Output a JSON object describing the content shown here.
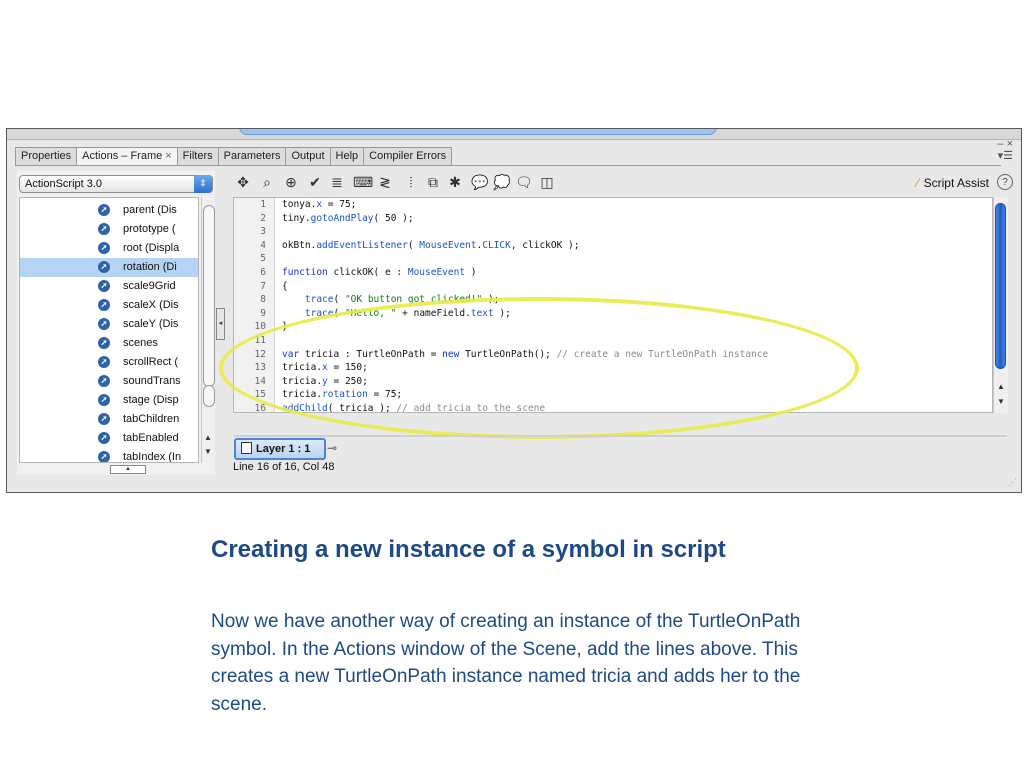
{
  "tabs": [
    {
      "label": "Properties",
      "active": false
    },
    {
      "label": "Actions – Frame",
      "active": true,
      "closable": true
    },
    {
      "label": "Filters",
      "active": false
    },
    {
      "label": "Parameters",
      "active": false
    },
    {
      "label": "Output",
      "active": false
    },
    {
      "label": "Help",
      "active": false
    },
    {
      "label": "Compiler Errors",
      "active": false
    }
  ],
  "panel_controls": {
    "minimize": "–",
    "close": "×",
    "menu": "▾☰"
  },
  "language_select": {
    "value": "ActionScript 3.0",
    "arrow": "⇕"
  },
  "tree_items": [
    {
      "label": "parent (Dis",
      "selected": false
    },
    {
      "label": "prototype (",
      "selected": false
    },
    {
      "label": "root (Displa",
      "selected": false
    },
    {
      "label": "rotation (Di",
      "selected": true
    },
    {
      "label": "scale9Grid",
      "selected": false
    },
    {
      "label": "scaleX (Dis",
      "selected": false
    },
    {
      "label": "scaleY (Dis",
      "selected": false
    },
    {
      "label": "scenes",
      "selected": false
    },
    {
      "label": "scrollRect (",
      "selected": false
    },
    {
      "label": "soundTrans",
      "selected": false
    },
    {
      "label": "stage (Disp",
      "selected": false
    },
    {
      "label": "tabChildren",
      "selected": false
    },
    {
      "label": "tabEnabled",
      "selected": false
    },
    {
      "label": "tabIndex (In",
      "selected": false
    }
  ],
  "toolbar": {
    "icons": [
      {
        "name": "add-statement-icon",
        "glyph": "✥"
      },
      {
        "name": "find-icon",
        "glyph": "⌕"
      },
      {
        "name": "target-path-icon",
        "glyph": "⊕"
      },
      {
        "name": "check-syntax-icon",
        "glyph": "✔"
      },
      {
        "name": "auto-format-icon",
        "glyph": "≣"
      },
      {
        "name": "code-hint-icon",
        "glyph": "⌨"
      },
      {
        "name": "debug-options-icon",
        "glyph": "≷"
      },
      {
        "name": "collapse-between-icon",
        "glyph": "⦙"
      },
      {
        "name": "collapse-selection-icon",
        "glyph": "⧉"
      },
      {
        "name": "expand-all-icon",
        "glyph": "✱"
      },
      {
        "name": "apply-block-comment-icon",
        "glyph": "💬"
      },
      {
        "name": "apply-line-comment-icon",
        "glyph": "💭"
      },
      {
        "name": "remove-comment-icon",
        "glyph": "🗨"
      },
      {
        "name": "show-hide-toolbox-icon",
        "glyph": "◫"
      }
    ],
    "script_assist_label": "Script Assist",
    "help_glyph": "?"
  },
  "code_lines": [
    {
      "n": "1",
      "html": "tonya.<span class=\"pr\">x</span> = 75;"
    },
    {
      "n": "2",
      "html": "tiny.<span class=\"pr\">gotoAndPlay</span>( 50 );"
    },
    {
      "n": "3",
      "html": ""
    },
    {
      "n": "4",
      "html": "okBtn.<span class=\"pr\">addEventListener</span>( <span class=\"pr\">MouseEvent</span>.<span class=\"pr\">CLICK</span>, clickOK );"
    },
    {
      "n": "5",
      "html": ""
    },
    {
      "n": "6",
      "html": "<span class=\"kw\">function</span> clickOK( e : <span class=\"pr\">MouseEvent</span> )"
    },
    {
      "n": "7",
      "html": "{"
    },
    {
      "n": "8",
      "html": "    <span class=\"pr\">trace</span>( <span class=\"st\">\"OK button got clicked!\"</span> );"
    },
    {
      "n": "9",
      "html": "    <span class=\"pr\">trace</span>( <span class=\"st\">\"Hello, \"</span> + nameField.<span class=\"pr\">text</span> );"
    },
    {
      "n": "10",
      "html": "}"
    },
    {
      "n": "11",
      "html": ""
    },
    {
      "n": "12",
      "html": "<span class=\"kw\">var</span> tricia : TurtleOnPath = <span class=\"kw\">new</span> TurtleOnPath(); <span class=\"cm\">// create a new TurtleOnPath instance</span>"
    },
    {
      "n": "13",
      "html": "tricia.<span class=\"pr\">x</span> = 150;"
    },
    {
      "n": "14",
      "html": "tricia.<span class=\"pr\">y</span> = 250;"
    },
    {
      "n": "15",
      "html": "tricia.<span class=\"pr\">rotation</span> = 75;"
    },
    {
      "n": "16",
      "html": "<span class=\"pr\">addChild</span>( tricia ); <span class=\"cm\">// add tricia to the scene</span>"
    }
  ],
  "layer_tab": "Layer 1 : 1",
  "status": "Line 16 of 16, Col 48",
  "caption": {
    "title": "Creating a new instance of a symbol in script",
    "body": "Now we have another way of creating an instance of the TurtleOnPath symbol. In the Actions window of the Scene, add the lines above. This creates a new TurtleOnPath instance named tricia and adds her to the scene."
  },
  "colors": {
    "caption": "#1d4a84",
    "highlight": "#e9ea48",
    "selection": "#b5d3f4"
  }
}
